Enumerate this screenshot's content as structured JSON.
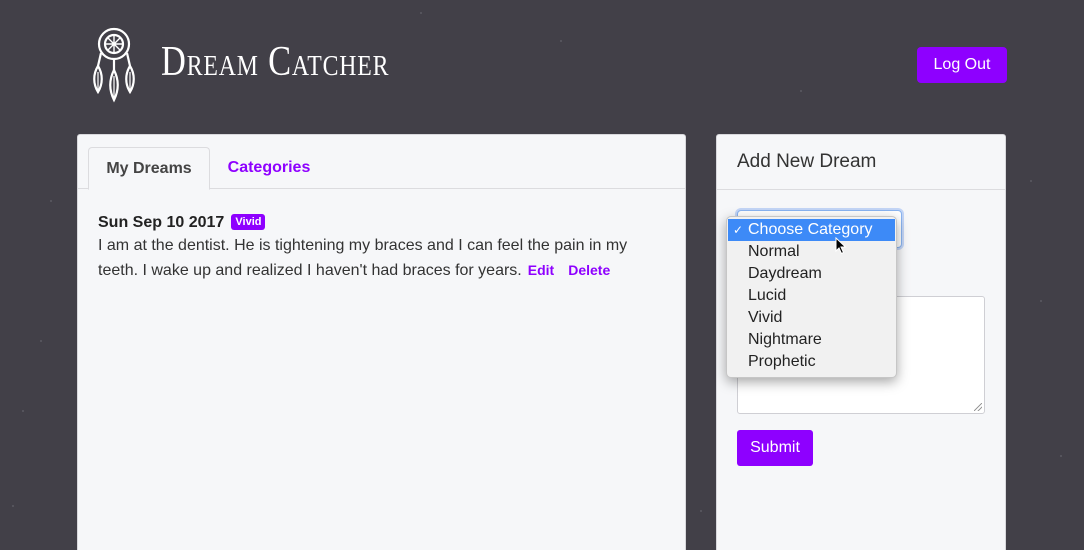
{
  "app": {
    "brand": "Dream Catcher",
    "logout_label": "Log Out",
    "accent_color": "#8e00ff",
    "background_color": "#424048"
  },
  "tabs": [
    {
      "label": "My Dreams",
      "active": true
    },
    {
      "label": "Categories",
      "active": false
    }
  ],
  "dreams": [
    {
      "date": "Sun Sep 10 2017",
      "category": "Vivid",
      "text": "I am at the dentist. He is tightening my braces and I can feel the pain in my teeth. I wake up and realized I haven't had braces for years.",
      "edit_label": "Edit",
      "delete_label": "Delete"
    }
  ],
  "add_form": {
    "title": "Add New Dream",
    "category_select": {
      "selected": "Choose Category",
      "options": [
        "Choose Category",
        "Normal",
        "Daydream",
        "Lucid",
        "Vivid",
        "Nightmare",
        "Prophetic"
      ]
    },
    "submit_label": "Submit"
  },
  "icons": {
    "logo": "dreamcatcher-icon",
    "check": "checkmark-icon",
    "cursor": "mouse-pointer-icon"
  }
}
